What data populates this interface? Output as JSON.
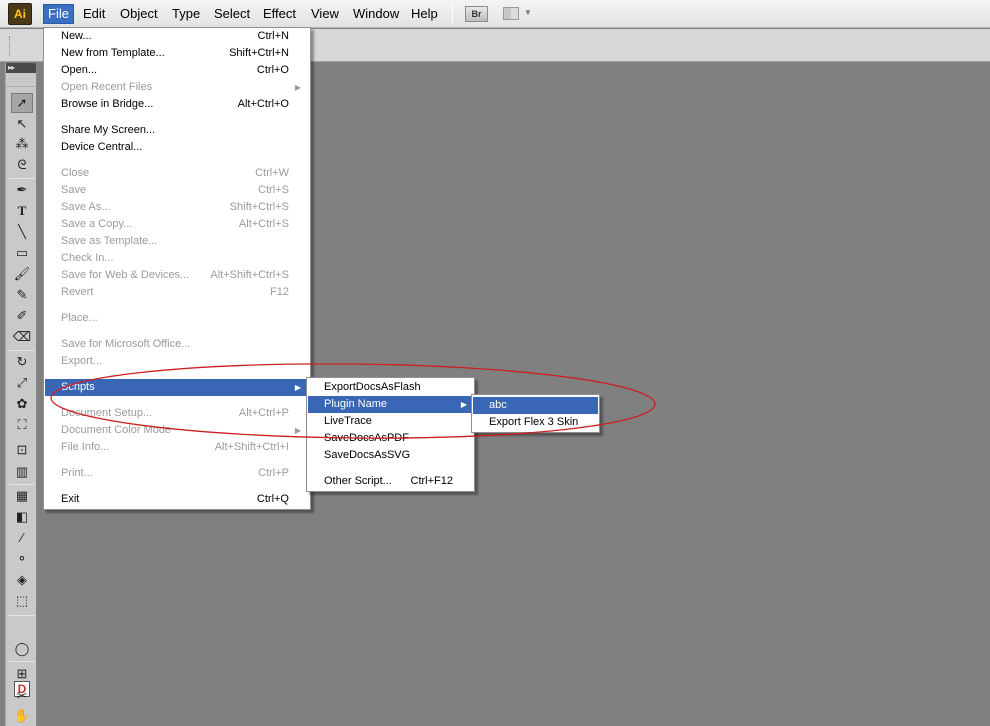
{
  "app": {
    "logo_text": "Ai",
    "bridge_label": "Br"
  },
  "menubar": {
    "items": [
      {
        "label": "File",
        "active": true
      },
      {
        "label": "Edit"
      },
      {
        "label": "Object"
      },
      {
        "label": "Type"
      },
      {
        "label": "Select"
      },
      {
        "label": "Effect"
      },
      {
        "label": "View"
      },
      {
        "label": "Window"
      },
      {
        "label": "Help"
      }
    ]
  },
  "file_menu": {
    "items": [
      {
        "label": "New...",
        "shortcut": "Ctrl+N"
      },
      {
        "label": "New from Template...",
        "shortcut": "Shift+Ctrl+N"
      },
      {
        "label": "Open...",
        "shortcut": "Ctrl+O"
      },
      {
        "label": "Open Recent Files",
        "shortcut": "",
        "disabled": true,
        "submenu": true
      },
      {
        "label": "Browse in Bridge...",
        "shortcut": "Alt+Ctrl+O"
      },
      {
        "label": "Share My Screen...",
        "shortcut": ""
      },
      {
        "label": "Device Central...",
        "shortcut": ""
      },
      {
        "label": "Close",
        "shortcut": "Ctrl+W",
        "disabled": true
      },
      {
        "label": "Save",
        "shortcut": "Ctrl+S",
        "disabled": true
      },
      {
        "label": "Save As...",
        "shortcut": "Shift+Ctrl+S",
        "disabled": true
      },
      {
        "label": "Save a Copy...",
        "shortcut": "Alt+Ctrl+S",
        "disabled": true
      },
      {
        "label": "Save as Template...",
        "shortcut": "",
        "disabled": true
      },
      {
        "label": "Check In...",
        "shortcut": "",
        "disabled": true
      },
      {
        "label": "Save for Web & Devices...",
        "shortcut": "Alt+Shift+Ctrl+S",
        "disabled": true
      },
      {
        "label": "Revert",
        "shortcut": "F12",
        "disabled": true
      },
      {
        "label": "Place...",
        "shortcut": "",
        "disabled": true
      },
      {
        "label": "Save for Microsoft Office...",
        "shortcut": "",
        "disabled": true
      },
      {
        "label": "Export...",
        "shortcut": "",
        "disabled": true
      },
      {
        "label": "Scripts",
        "shortcut": "",
        "highlight": true,
        "submenu": true
      },
      {
        "label": "Document Setup...",
        "shortcut": "Alt+Ctrl+P",
        "disabled": true
      },
      {
        "label": "Document Color Mode",
        "shortcut": "",
        "disabled": true,
        "submenu": true
      },
      {
        "label": "File Info...",
        "shortcut": "Alt+Shift+Ctrl+I",
        "disabled": true
      },
      {
        "label": "Print...",
        "shortcut": "Ctrl+P",
        "disabled": true
      },
      {
        "label": "Exit",
        "shortcut": "Ctrl+Q"
      }
    ]
  },
  "scripts_menu": {
    "items": [
      {
        "label": "ExportDocsAsFlash",
        "shortcut": ""
      },
      {
        "label": "Plugin Name",
        "shortcut": "",
        "highlight": true,
        "submenu": true
      },
      {
        "label": "LiveTrace",
        "shortcut": ""
      },
      {
        "label": "SaveDocsAsPDF",
        "shortcut": ""
      },
      {
        "label": "SaveDocsAsSVG",
        "shortcut": ""
      },
      {
        "label": "Other Script...",
        "shortcut": "Ctrl+F12"
      }
    ]
  },
  "plugin_menu": {
    "items": [
      {
        "label": "abc",
        "highlight": true
      },
      {
        "label": "Export Flex 3 Skin"
      }
    ]
  },
  "colors": {
    "highlight": "#3967b6",
    "workspace": "#808080",
    "annotation": "#cc1f1f"
  },
  "tools": {
    "icons": [
      "selection-arrow-icon",
      "direct-selection-icon",
      "magic-wand-icon",
      "lasso-icon",
      "pen-icon",
      "type-icon",
      "line-segment-icon",
      "rectangle-icon",
      "paintbrush-icon",
      "pencil-icon",
      "blob-brush-icon",
      "eraser-icon",
      "rotate-icon",
      "scale-icon",
      "warp-icon",
      "free-transform-icon",
      "symbol-sprayer-icon",
      "column-graph-icon",
      "mesh-icon",
      "gradient-icon",
      "eyedropper-icon",
      "blend-icon",
      "live-paint-bucket-icon",
      "live-paint-selection-icon",
      "fill-stroke-icon",
      "draw-mode-icon",
      "artboard-icon",
      "slice-icon",
      "hand-icon"
    ]
  }
}
